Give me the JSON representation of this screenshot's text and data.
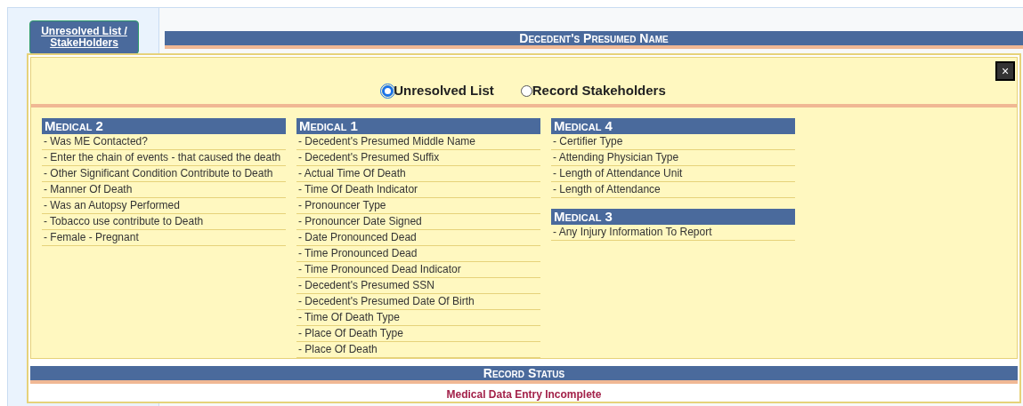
{
  "sidebar_button": "Unresolved List / StakeHolders",
  "header": "Decedent's Presumed Name",
  "dialog": {
    "close": "×",
    "radios": [
      {
        "label": "Unresolved List",
        "selected": true
      },
      {
        "label": "Record Stakeholders",
        "selected": false
      }
    ],
    "columns": [
      [
        {
          "title": "Medical 2",
          "items": [
            "- Was ME Contacted?",
            "- Enter the chain of events - that caused the death",
            "- Other Significant Condition Contribute to Death",
            "- Manner Of Death",
            "- Was an Autopsy Performed",
            "- Tobacco use contribute to Death",
            "- Female - Pregnant"
          ]
        }
      ],
      [
        {
          "title": "Medical 1",
          "items": [
            "- Decedent's Presumed Middle Name",
            "- Decedent's Presumed Suffix",
            "- Actual Time Of Death",
            "- Time Of Death Indicator",
            "- Pronouncer Type",
            "- Pronouncer Date Signed",
            "- Date Pronounced Dead",
            "- Time Pronounced Dead",
            "- Time Pronounced Dead Indicator",
            "- Decedent's Presumed SSN",
            "- Decedent's Presumed Date Of Birth",
            "- Time Of Death Type",
            "- Place Of Death Type",
            "- Place Of Death"
          ]
        }
      ],
      [
        {
          "title": "Medical 4",
          "items": [
            "- Certifier Type",
            "- Attending Physician Type",
            "- Length of Attendance Unit",
            "- Length of Attendance"
          ]
        },
        {
          "title": "Medical 3",
          "items": [
            "- Any Injury Information To Report"
          ]
        }
      ]
    ],
    "status_title": "Record Status",
    "status": "Medical Data Entry Incomplete"
  }
}
